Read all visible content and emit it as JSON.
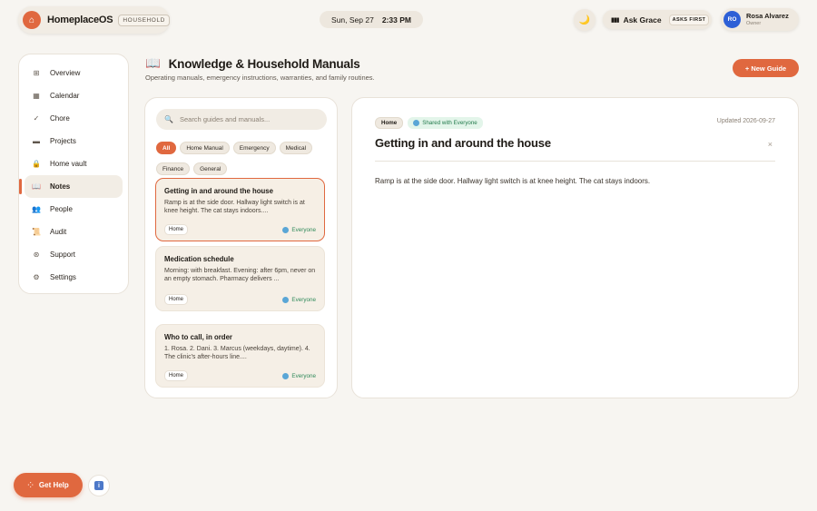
{
  "brand": {
    "logo_glyph": "⌂",
    "name": "HomeplaceOS",
    "tag": "HOUSEHOLD"
  },
  "clock": {
    "date": "Sun, Sep 27",
    "time": "2:33 PM"
  },
  "theme_toggle": {
    "icon": "moon-icon",
    "glyph": "🌙"
  },
  "assistant": {
    "label": "Ask Grace",
    "tag": "ASKS FIRST",
    "glyph": "▮▮▮"
  },
  "user": {
    "initials": "RO",
    "name": "Rosa Alvarez",
    "role": "Owner"
  },
  "sidebar": {
    "items": [
      {
        "label": "Overview",
        "icon": "grid-icon",
        "glyph": "⊞"
      },
      {
        "label": "Calendar",
        "icon": "calendar-icon",
        "glyph": "▦"
      },
      {
        "label": "Chore",
        "icon": "check-icon",
        "glyph": "✓"
      },
      {
        "label": "Projects",
        "icon": "folder-icon",
        "glyph": "▬"
      },
      {
        "label": "Home vault",
        "icon": "lock-icon",
        "glyph": "🔒"
      },
      {
        "label": "Notes",
        "icon": "book-icon",
        "glyph": "📖"
      },
      {
        "label": "People",
        "icon": "people-icon",
        "glyph": "👥"
      },
      {
        "label": "Audit",
        "icon": "scroll-icon",
        "glyph": "📜"
      },
      {
        "label": "Support",
        "icon": "lifebuoy-icon",
        "glyph": "⊛"
      },
      {
        "label": "Settings",
        "icon": "gear-icon",
        "glyph": "⚙"
      }
    ],
    "active_index": 5
  },
  "header": {
    "title_glyph": "📖",
    "title": "Knowledge & Household Manuals",
    "subtitle": "Operating manuals, emergency instructions, warranties, and family routines.",
    "new_button": "+ New Guide"
  },
  "search": {
    "placeholder": "Search guides and manuals...",
    "value": ""
  },
  "filters": [
    "All",
    "Home Manual",
    "Emergency",
    "Medical",
    "Finance",
    "General"
  ],
  "active_filter": "All",
  "guides": [
    {
      "title": "Getting in and around the house",
      "excerpt": "Ramp is at the side door. Hallway light switch is at knee height. The cat stays indoors....",
      "tag": "Home",
      "visibility": "Everyone"
    },
    {
      "title": "Medication schedule",
      "excerpt": "Morning: with breakfast. Evening: after 6pm, never on an empty stomach. Pharmacy delivers ...",
      "tag": "Home",
      "visibility": "Everyone"
    },
    {
      "title": "Who to call, in order",
      "excerpt": "1. Rosa. 2. Dani. 3. Marcus (weekdays, daytime). 4. The clinic's after-hours line....",
      "tag": "Home",
      "visibility": "Everyone"
    }
  ],
  "detail": {
    "tag": "Home",
    "shared": "Shared with Everyone",
    "updated": "Updated 2026-09-27",
    "title": "Getting in and around the house",
    "close_glyph": "×",
    "body": "Ramp is at the side door. Hallway light switch is at knee height. The cat stays indoors."
  },
  "help": {
    "label": "Get Help",
    "glyph": "⁘",
    "info_glyph": "i"
  },
  "colors": {
    "accent": "#e0683f",
    "background": "#f7f5f1",
    "shared_green": "#227a4c",
    "avatar_blue": "#2d5fd6"
  }
}
